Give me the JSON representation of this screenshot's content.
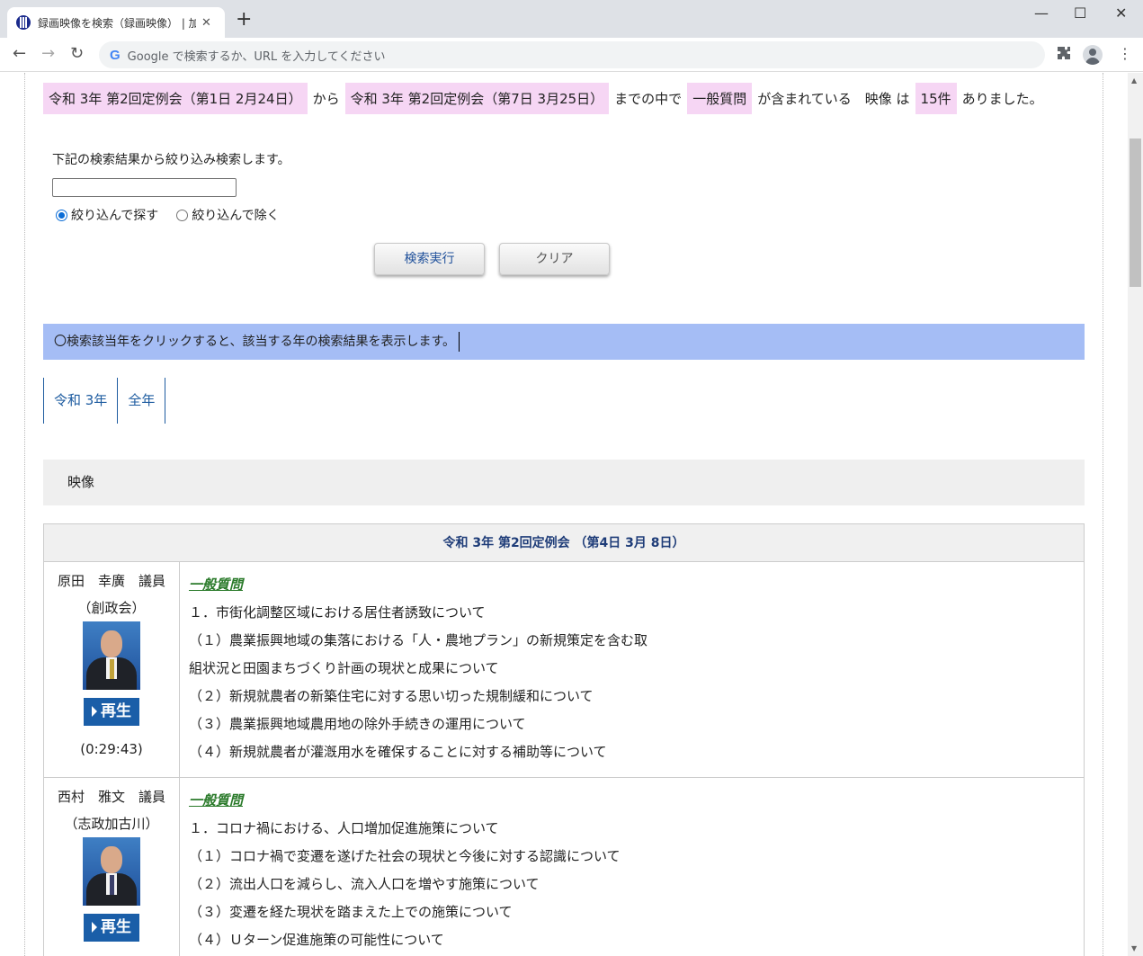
{
  "browser": {
    "tab_title": "録画映像を検索（録画映像） | 加",
    "tab_close": "✕",
    "new_tab": "+",
    "omnibox_placeholder": "Google で検索するか、URL を入力してください",
    "google_g": "G",
    "window_controls": {
      "minimize": "—",
      "maximize": "☐",
      "close": "✕"
    },
    "nav": {
      "back": "←",
      "forward": "→",
      "reload": "↻"
    },
    "menu": "⋮"
  },
  "summary": {
    "from": "令和 3年 第2回定例会（第1日 2月24日）",
    "kara": "から",
    "to": "令和 3年 第2回定例会（第7日 3月25日）",
    "made": "までの中で",
    "keyword": "一般質問",
    "contains": "が含まれている　映像 は",
    "count": "15件",
    "ending": "ありました。"
  },
  "refine": {
    "label": "下記の検索結果から絞り込み検索します。",
    "input_value": "",
    "radio_include": "絞り込んで探す",
    "radio_exclude": "絞り込んで除く",
    "search_button": "検索実行",
    "clear_button": "クリア"
  },
  "notice": "〇検索該当年をクリックすると、該当する年の検索結果を表示します。",
  "year_tabs": [
    "令和 3年",
    "全年"
  ],
  "video_section": "映像",
  "results": {
    "meeting_title": "令和 3年 第2回定例会 （第4日 3月 8日）",
    "play_label": "再生",
    "rows": [
      {
        "name": "原田　幸廣　議員",
        "party": "（創政会）",
        "duration": "(0:29:43)",
        "topic": "一般質問",
        "lines": [
          "１．市街化調整区域における居住者誘致について",
          "（１）農業振興地域の集落における「人・農地プラン」の新規策定を含む取",
          "組状況と田園まちづくり計画の現状と成果について",
          "（２）新規就農者の新築住宅に対する思い切った規制緩和について",
          "（３）農業振興地域農用地の除外手続きの運用について",
          "（４）新規就農者が灌漑用水を確保することに対する補助等について"
        ]
      },
      {
        "name": "西村　雅文　議員",
        "party": "（志政加古川）",
        "duration": "",
        "topic": "一般質問",
        "lines": [
          "１．コロナ禍における、人口増加促進施策について",
          "（１）コロナ禍で変遷を遂げた社会の現状と今後に対する認識について",
          "（２）流出人口を減らし、流入人口を増やす施策について",
          "（３）変遷を経た現状を踏まえた上での施策について",
          "（４）Ｕターン促進施策の可能性について"
        ]
      }
    ]
  },
  "back_to_top": "︿"
}
